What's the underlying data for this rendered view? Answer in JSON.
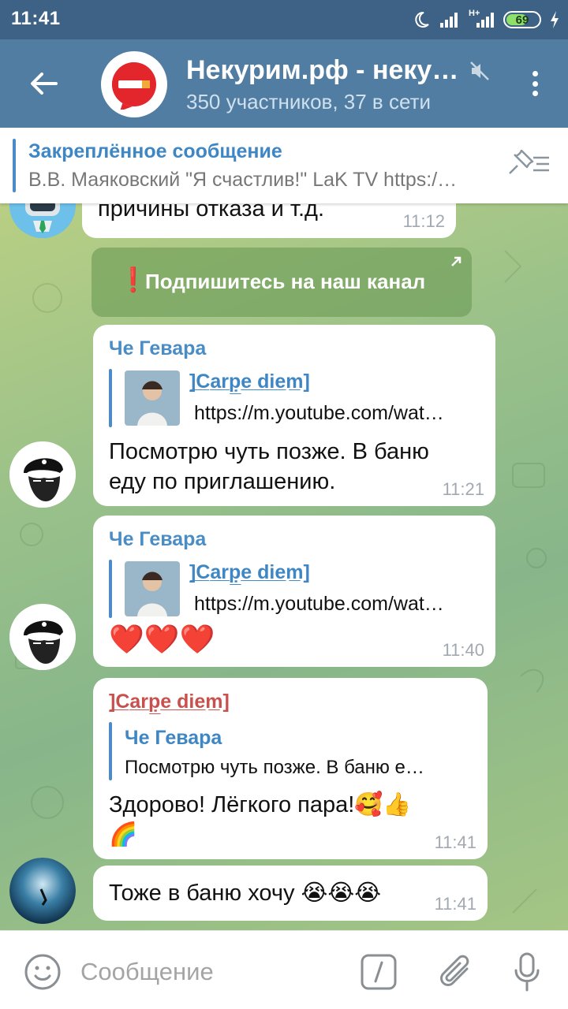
{
  "status_bar": {
    "time": "11:41",
    "network": "H+",
    "battery": "69",
    "battery_fraction": 0.69
  },
  "header": {
    "title": "Некурим.рф - неку…",
    "subtitle": "350 участников, 37 в сети",
    "icons": {
      "back": "arrow-left-icon",
      "muted": "muted-speaker-icon",
      "menu": "more-vertical-icon"
    }
  },
  "pinned": {
    "title": "Закреплённое сообщение",
    "text": "В.В. Маяковский \"Я счастлив!\" LaK TV https:/…"
  },
  "messages": [
    {
      "type": "text",
      "text": "причины отказа и т.д.",
      "time": "11:12"
    },
    {
      "type": "service",
      "icon": "❗",
      "text": "Подпишитесь на наш канал"
    },
    {
      "type": "link",
      "sender": "Че Гевара",
      "preview_title": "]̲C̲a̲r̲p̲e̲ ̲d̲i̲e̲m̲]",
      "preview_url": "https://m.youtube.com/wat…",
      "text_line1": "Посмотрю чуть позже. В баню",
      "text_line2": "еду по приглашению.",
      "time": "11:21"
    },
    {
      "type": "link",
      "sender": "Че Гевара",
      "preview_title": "]̲C̲a̲r̲p̲e̲ ̲d̲i̲e̲m̲]",
      "preview_url": "https://m.youtube.com/wat…",
      "emoji": "❤️❤️❤️",
      "time": "11:40"
    },
    {
      "type": "reply",
      "sender": "]̲C̲a̲r̲p̲e̲ ̲d̲i̲e̲m̲]",
      "reply_to": "Че Гевара",
      "reply_text": "Посмотрю чуть позже. В баню е…",
      "text_line1": "Здорово! Лёгкого пара!🥰👍",
      "text_line2": "🌈",
      "time": "11:41"
    },
    {
      "type": "text",
      "text": "Тоже в баню хочу 😭😭😭",
      "time": "11:41"
    }
  ],
  "input": {
    "placeholder": "Сообщение",
    "icons": [
      "emoji-icon",
      "command-icon",
      "attach-icon",
      "microphone-icon"
    ]
  },
  "colors": {
    "header": "#517da2",
    "status_bar": "#3e6285",
    "accent": "#4a8dc4",
    "reply_sender": "#c9514d"
  }
}
